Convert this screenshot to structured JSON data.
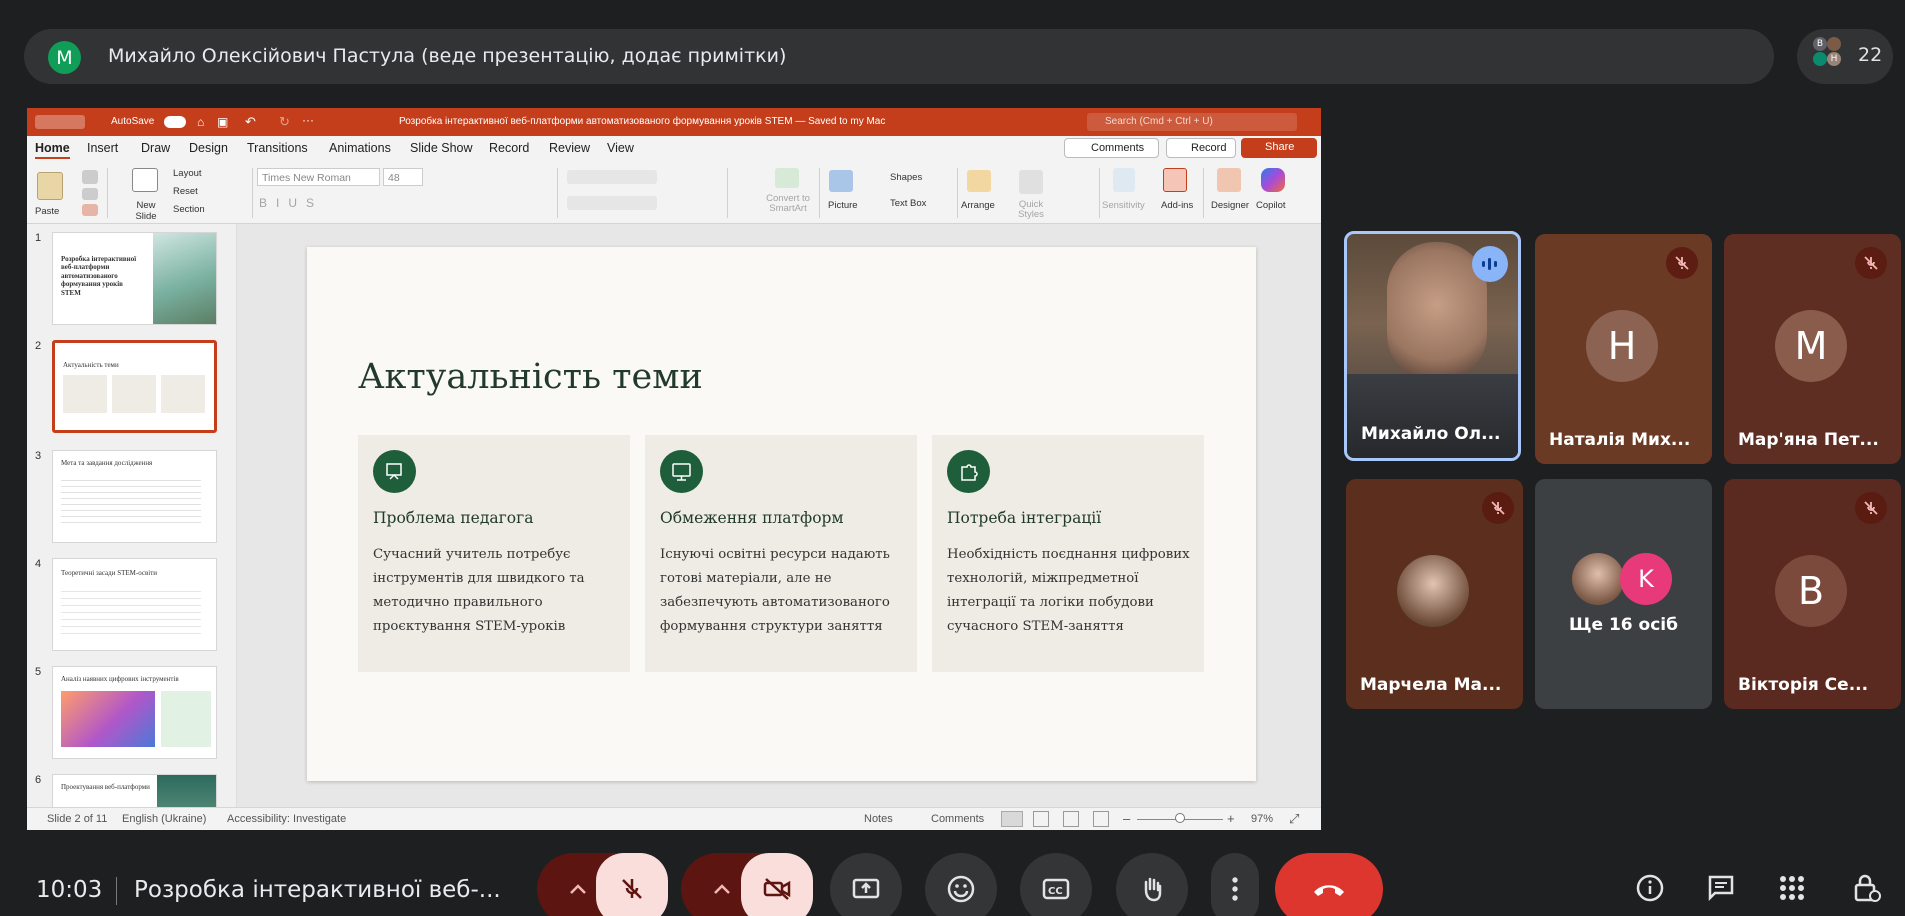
{
  "meet": {
    "presenter_initial": "M",
    "presenter_title": "Михайло Олексійович Пастула (веде презентацію, додає примітки)",
    "people_avatars": [
      "B",
      "Н",
      "М"
    ],
    "people_count": "22",
    "time": "10:03",
    "meeting_title": "Розробка інтерактивної веб-...",
    "tiles": [
      {
        "name": "Михайло Ол...",
        "type": "video"
      },
      {
        "name": "Наталія Мих...",
        "initial": "Н"
      },
      {
        "name": "Мар'яна Пет...",
        "initial": "М"
      },
      {
        "name": "Марчела Ма...",
        "type": "photo"
      },
      {
        "name": "Ще 16 осіб",
        "initial": "K"
      },
      {
        "name": "Вікторія Се...",
        "initial": "В"
      }
    ]
  },
  "ppt": {
    "autosave": "AutoSave",
    "doc_title": "Розробка інтерактивної веб-платформи автоматизованого формування уроків STEM — Saved to my Mac",
    "search_placeholder": "Search (Cmd + Ctrl + U)",
    "tabs": [
      "Home",
      "Insert",
      "Draw",
      "Design",
      "Transitions",
      "Animations",
      "Slide Show",
      "Record",
      "Review",
      "View"
    ],
    "comments_btn": "Comments",
    "record_btn": "Record",
    "share_btn": "Share",
    "ribbon": {
      "paste": "Paste",
      "new_slide": "New Slide",
      "layout": "Layout",
      "reset": "Reset",
      "section": "Section",
      "font": "Times New Roman",
      "size": "48",
      "convert": "Convert to SmartArt",
      "picture": "Picture",
      "shapes": "Shapes",
      "text_box": "Text Box",
      "arrange": "Arrange",
      "quick_styles": "Quick Styles",
      "sensitivity": "Sensitivity",
      "addins": "Add-ins",
      "designer": "Designer",
      "copilot": "Copilot"
    },
    "thumbnails": [
      {
        "num": "1",
        "title": "Розробка інтерактивної веб-платформи автоматизованого формування уроків STEM"
      },
      {
        "num": "2",
        "title": "Актуальність теми"
      },
      {
        "num": "3",
        "title": "Мета та завдання дослідження"
      },
      {
        "num": "4",
        "title": "Теоретичні засади STEM-освіти"
      },
      {
        "num": "5",
        "title": "Аналіз наявних цифрових інструментів"
      },
      {
        "num": "6",
        "title": "Проектування веб-платформи"
      }
    ],
    "slide": {
      "title": "Актуальність теми",
      "cards": [
        {
          "heading": "Проблема педагога",
          "body": "Сучасний учитель потребує інструментів для швидкого та методично правильного проєктування STEM-уроків"
        },
        {
          "heading": "Обмеження платформ",
          "body": "Існуючі освітні ресурси надають готові матеріали, але не забезпечують автоматизованого формування структури заняття"
        },
        {
          "heading": "Потреба інтеграції",
          "body": "Необхідність поєднання цифрових технологій, міжпредметної інтеграції та логіки побудови сучасного STEM-заняття"
        }
      ]
    },
    "status": {
      "slide_of": "Slide 2 of 11",
      "language": "English (Ukraine)",
      "accessibility": "Accessibility: Investigate",
      "notes": "Notes",
      "comments": "Comments",
      "zoom": "97%"
    }
  },
  "colors": {
    "ppt_accent": "#c43e1c",
    "slide_green": "#1f5e3a",
    "end_call": "#dc362e",
    "mic_off_bg": "#f9dedc"
  }
}
